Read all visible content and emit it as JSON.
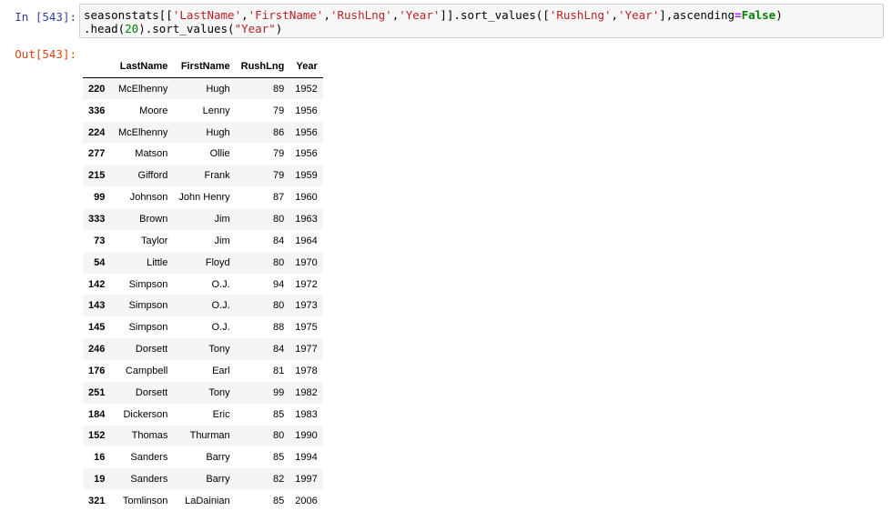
{
  "cell": {
    "in_prompt": "In [543]:",
    "out_prompt": "Out[543]:",
    "code": {
      "l1_a": "seasonstats[[",
      "l1_s1": "'LastName'",
      "l1_c1": ",",
      "l1_s2": "'FirstName'",
      "l1_c2": ",",
      "l1_s3": "'RushLng'",
      "l1_c3": ",",
      "l1_s4": "'Year'",
      "l1_b": "]].sort_values([",
      "l1_s5": "'RushLng'",
      "l1_c4": ",",
      "l1_s6": "'Year'",
      "l1_c": "],ascending",
      "l1_eq": "=",
      "l1_kw": "False",
      "l1_d": ")",
      "l2_a": ".head(",
      "l2_num": "20",
      "l2_b": ").sort_values(",
      "l2_s1": "\"Year\"",
      "l2_c": ")"
    }
  },
  "table": {
    "columns": [
      "",
      "LastName",
      "FirstName",
      "RushLng",
      "Year"
    ],
    "rows": [
      {
        "idx": "220",
        "last": "McElhenny",
        "first": "Hugh",
        "rush": "89",
        "year": "1952"
      },
      {
        "idx": "336",
        "last": "Moore",
        "first": "Lenny",
        "rush": "79",
        "year": "1956"
      },
      {
        "idx": "224",
        "last": "McElhenny",
        "first": "Hugh",
        "rush": "86",
        "year": "1956"
      },
      {
        "idx": "277",
        "last": "Matson",
        "first": "Ollie",
        "rush": "79",
        "year": "1956"
      },
      {
        "idx": "215",
        "last": "Gifford",
        "first": "Frank",
        "rush": "79",
        "year": "1959"
      },
      {
        "idx": "99",
        "last": "Johnson",
        "first": "John Henry",
        "rush": "87",
        "year": "1960"
      },
      {
        "idx": "333",
        "last": "Brown",
        "first": "Jim",
        "rush": "80",
        "year": "1963"
      },
      {
        "idx": "73",
        "last": "Taylor",
        "first": "Jim",
        "rush": "84",
        "year": "1964"
      },
      {
        "idx": "54",
        "last": "Little",
        "first": "Floyd",
        "rush": "80",
        "year": "1970"
      },
      {
        "idx": "142",
        "last": "Simpson",
        "first": "O.J.",
        "rush": "94",
        "year": "1972"
      },
      {
        "idx": "143",
        "last": "Simpson",
        "first": "O.J.",
        "rush": "80",
        "year": "1973"
      },
      {
        "idx": "145",
        "last": "Simpson",
        "first": "O.J.",
        "rush": "88",
        "year": "1975"
      },
      {
        "idx": "246",
        "last": "Dorsett",
        "first": "Tony",
        "rush": "84",
        "year": "1977"
      },
      {
        "idx": "176",
        "last": "Campbell",
        "first": "Earl",
        "rush": "81",
        "year": "1978"
      },
      {
        "idx": "251",
        "last": "Dorsett",
        "first": "Tony",
        "rush": "99",
        "year": "1982"
      },
      {
        "idx": "184",
        "last": "Dickerson",
        "first": "Eric",
        "rush": "85",
        "year": "1983"
      },
      {
        "idx": "152",
        "last": "Thomas",
        "first": "Thurman",
        "rush": "80",
        "year": "1990"
      },
      {
        "idx": "16",
        "last": "Sanders",
        "first": "Barry",
        "rush": "85",
        "year": "1994"
      },
      {
        "idx": "19",
        "last": "Sanders",
        "first": "Barry",
        "rush": "82",
        "year": "1997"
      },
      {
        "idx": "321",
        "last": "Tomlinson",
        "first": "LaDainian",
        "rush": "85",
        "year": "2006"
      }
    ]
  }
}
